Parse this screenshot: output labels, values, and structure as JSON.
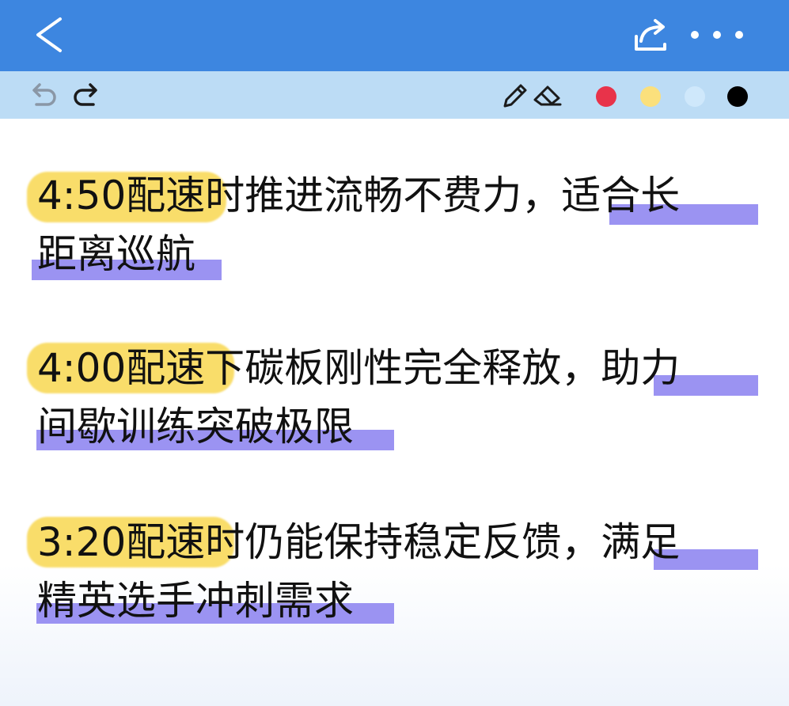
{
  "header": {
    "back_icon": "chevron-left-icon",
    "share_icon": "share-icon",
    "more_icon": "more-dots-icon",
    "bg_color": "#3d86e0"
  },
  "toolbar": {
    "undo_icon": "undo-icon",
    "redo_icon": "redo-icon",
    "pen_icon": "pencil-icon",
    "eraser_icon": "eraser-icon",
    "bg_color": "#bcdcf5",
    "colors": [
      "#e8334a",
      "#fbe07c",
      "#cfe8fb",
      "#000000"
    ]
  },
  "note": {
    "paragraphs": [
      {
        "line1_pace": "4:50配速",
        "line1_mid": "时推进流畅不费力，",
        "line1_tail": "适合长",
        "line2": "距离巡航"
      },
      {
        "line1_pace": "4:00配速",
        "line1_mid": "下碳板刚性完全释放，",
        "line1_tail": "助力",
        "line2": "间歇训练突破极限"
      },
      {
        "line1_pace": "3:20配速",
        "line1_mid": "时仍能保持稳定反馈，",
        "line1_tail": "满足",
        "line2": "精英选手冲刺需求"
      }
    ],
    "highlight_yellow": "#f9dd6a",
    "highlight_purple": "#9b93f2"
  }
}
